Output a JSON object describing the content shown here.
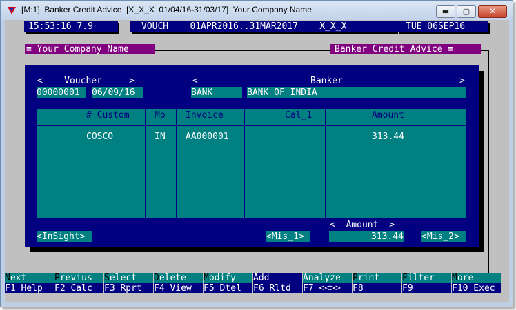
{
  "window": {
    "title": "[M:1]  Banker Credit Advice  [X_X_X  01/04/16-31/03/17]  Your Company Name",
    "min_label": "▬",
    "max_label": "▢",
    "close_label": "✕"
  },
  "statusbar": {
    "time": "15:53:16 7.9",
    "context": "VOUCH    01APR2016..31MAR2017    X_X_X",
    "date": "TUE 06SEP16"
  },
  "frame": {
    "company_tab": "≡ Your Company Name",
    "module_tab": "Banker Credit Advice ≡"
  },
  "form": {
    "voucher_label": "<    Voucher     >",
    "banker_label_left": "<",
    "banker_label": "Banker",
    "banker_label_right": ">",
    "voucher_no": "00000001",
    "voucher_date": "06/09/16",
    "bank_code": "BANK",
    "bank_name": "BANK OF INDIA"
  },
  "grid": {
    "columns": [
      "# Custom",
      "Mo",
      "Invoice",
      "Cal_1",
      "Amount"
    ],
    "rows": [
      {
        "custom": "COSCO",
        "mo": "IN",
        "invoice": "AA000001",
        "cal1": "",
        "amount": "313.44"
      }
    ]
  },
  "footer": {
    "insight_button": "<InSight>",
    "mis1_button": "<Mis_1>",
    "amount_label": "<  Amount  >",
    "amount_total": "313.44",
    "mis2_button": "<Mis_2>"
  },
  "fkeys": [
    {
      "hot": "N",
      "rest": "ext",
      "bottom": "F1 Help"
    },
    {
      "hot": "P",
      "rest": "revius",
      "bottom": "F2 Calc"
    },
    {
      "hot": "S",
      "rest": "elect",
      "bottom": "F3 Rprt"
    },
    {
      "hot": "D",
      "rest": "elete",
      "bottom": "F4 View"
    },
    {
      "hot": "M",
      "rest": "odify",
      "bottom": "F5 Dtel"
    },
    {
      "hot": "A",
      "rest": "dd",
      "bottom": "F6 Rltd"
    },
    {
      "hot": "",
      "rest": "Analyze",
      "bottom": "F7 <<>>"
    },
    {
      "hot": "P",
      "rest": "rint",
      "bottom": "F8"
    },
    {
      "hot": "F",
      "rest": "ilter",
      "bottom": "F9"
    },
    {
      "hot": "M",
      "rest": "ore",
      "bottom": "F10 Exec"
    }
  ],
  "colors": {
    "navy": "#000080",
    "teal": "#008080",
    "magenta": "#800080",
    "background": "#c0c0c0"
  }
}
